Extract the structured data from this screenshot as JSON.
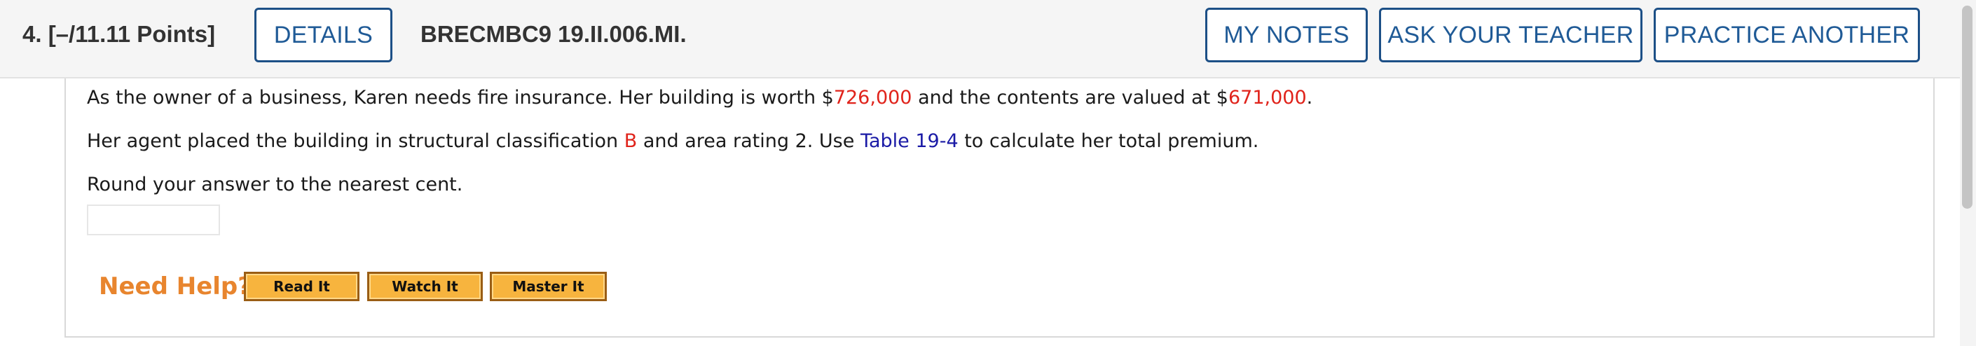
{
  "question": {
    "number_points": "4.  [–/11.11 Points]",
    "code": "BRECMBC9 19.II.006.MI."
  },
  "header_buttons": {
    "details": "DETAILS",
    "my_notes": "MY NOTES",
    "ask_teacher": "ASK YOUR TEACHER",
    "practice_another": "PRACTICE ANOTHER"
  },
  "problem": {
    "line1": {
      "t1": "As the owner of a business, Karen needs fire insurance. Her building is worth $",
      "building_value": "726,000",
      "t2": " and the contents are valued at $",
      "contents_value": "671,000",
      "t3": "."
    },
    "line2": {
      "t1": "Her agent placed the building in structural classification ",
      "classification": "B",
      "t2": " and area rating 2. Use ",
      "table_link": "Table 19-4",
      "t3": " to calculate her total premium."
    },
    "line3": "Round your answer to the nearest cent."
  },
  "answer": {
    "value": "",
    "placeholder": ""
  },
  "help": {
    "label": "Need Help?",
    "read_it": "Read It",
    "watch_it": "Watch It",
    "master_it": "Master It"
  },
  "colors": {
    "accent_blue": "#1f5a96",
    "value_red": "#e0231b",
    "link_blue": "#1a1aa6",
    "help_orange": "#e8852e",
    "help_button": "#f7b43e"
  }
}
